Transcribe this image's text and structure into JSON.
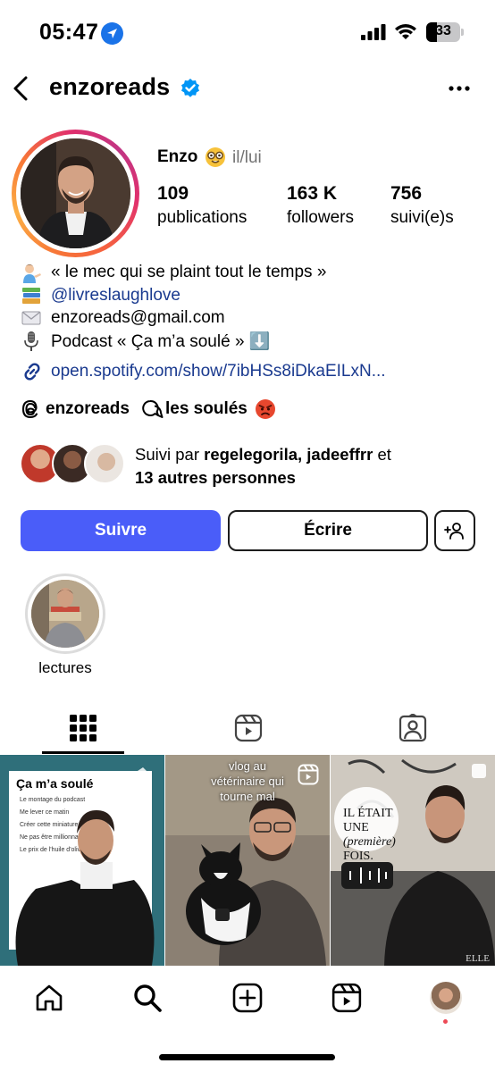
{
  "status_bar": {
    "time": "05:47",
    "battery": "33"
  },
  "header": {
    "username": "enzoreads"
  },
  "profile": {
    "name": "Enzo",
    "name_emoji": "🤓",
    "pronouns": "il/lui",
    "stats": [
      {
        "value": "109",
        "label": "publications"
      },
      {
        "value": "163 K",
        "label": "followers"
      },
      {
        "value": "756",
        "label": "suivi(e)s"
      }
    ]
  },
  "bio": {
    "lines": [
      {
        "emoji": "man-tipping-hand",
        "text": "« le mec qui se plaint tout le temps »"
      },
      {
        "emoji": "books",
        "text": "@livreslaughlove"
      },
      {
        "emoji": "envelope",
        "text": "enzoreads@gmail.com"
      },
      {
        "emoji": "microphone",
        "text": "Podcast « Ça m’a soulé » ⬇️"
      }
    ],
    "link": "open.spotify.com/show/7ibHSs8iDkaEILxN..."
  },
  "threads": {
    "handle": "enzoreads",
    "channel": "les soulés",
    "channel_emoji": "😡"
  },
  "followed_by": {
    "prefix": "Suivi par ",
    "names": "regelegorila, jadeeffrr",
    "and": " et",
    "others": "13 autres personnes"
  },
  "actions": {
    "follow": "Suivre",
    "message": "Écrire"
  },
  "highlights": [
    {
      "label": "lectures"
    }
  ],
  "posts": [
    {
      "title": "Ça m’a soulé",
      "items": [
        "Le montage du podcast",
        "Me lever ce matin",
        "Créer cette miniature",
        "Ne pas être millionnaire",
        "Le prix de l'huile d'olive"
      ]
    },
    {
      "caption": "vlog au vétérinaire qui tourne mal"
    },
    {
      "overlay_lines": [
        "IL ÉTAIT",
        "UNE",
        "(première)",
        "FOIS."
      ],
      "mark": "ELLE"
    }
  ],
  "colors": {
    "accent_blue": "#4a5df9",
    "link": "#1a3a8f",
    "verified": "#0095f6",
    "notification": "#ed4956"
  }
}
